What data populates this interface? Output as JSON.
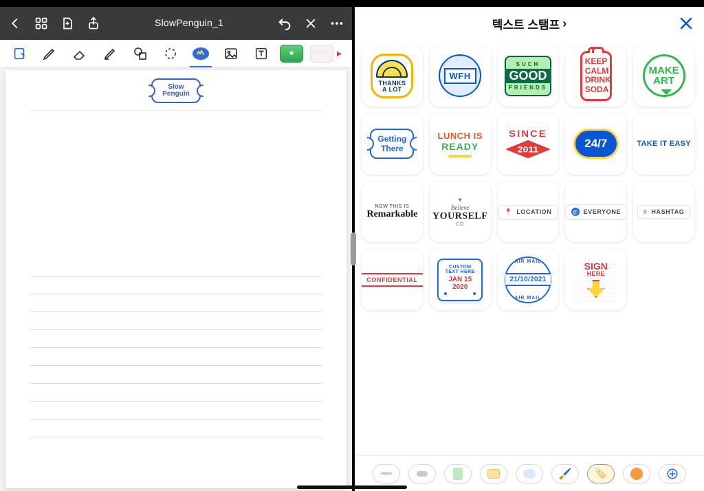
{
  "nav": {
    "title": "SlowPenguin_1"
  },
  "paper": {
    "stamp_line1": "Slow",
    "stamp_line2": "Penguin"
  },
  "panel": {
    "title": "텍스트 스탬프"
  },
  "stamps": {
    "thanks": {
      "label": "THANKS\nA LOT"
    },
    "wfh": {
      "label": "WFH"
    },
    "good": {
      "l1": "SUCH",
      "l2": "GOOD",
      "l3": "FRIENDS"
    },
    "keep": {
      "text": "KEEP CALM DRINK SODA"
    },
    "make": {
      "text": "MAKE ART"
    },
    "getting": {
      "text": "Getting There"
    },
    "lunch": {
      "l1": "LUNCH IS",
      "l2": "READY"
    },
    "since": {
      "l1": "SINCE",
      "l2": "2011"
    },
    "always": {
      "text": "24/7"
    },
    "easy": {
      "text": "TAKE IT EASY"
    },
    "remarkable": {
      "l1": "NOW THIS IS",
      "l2": "Remarkable"
    },
    "yourself": {
      "l1": "Believe",
      "l2": "YOURSELF",
      "l3": "CO"
    },
    "location": {
      "text": "LOCATION"
    },
    "everyone": {
      "text": "EVERYONE"
    },
    "hashtag": {
      "text": "HASHTAG"
    },
    "confidential": {
      "text": "CONFIDENTIAL"
    },
    "customcard": {
      "l1": "CUSTOM TEXT HERE",
      "l2": "JAN 15 2020"
    },
    "airmail": {
      "arc1": "AIR MAIL",
      "date": "21/10/2021",
      "arc2": "AIR MAIL"
    },
    "sign": {
      "l1": "SIGN",
      "l2": "HERE"
    }
  }
}
